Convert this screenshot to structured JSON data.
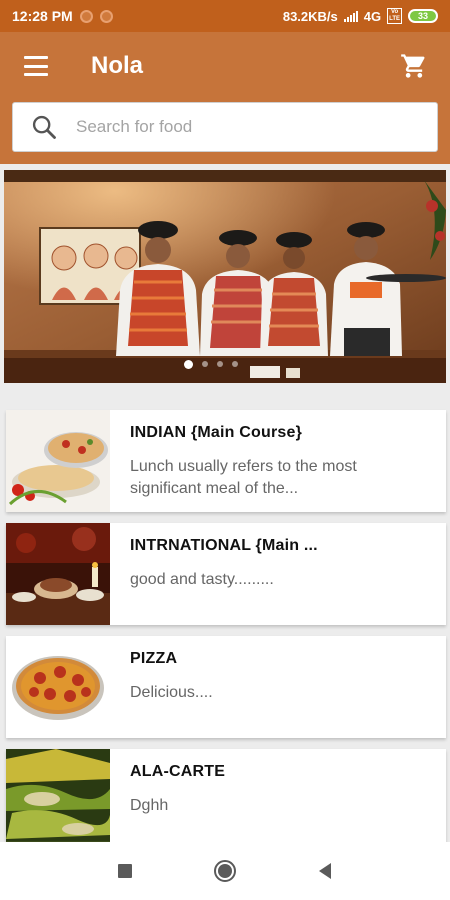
{
  "status_bar": {
    "time": "12:28 PM",
    "network_speed": "83.2KB/s",
    "network_type": "4G",
    "volte": "Vo LTE",
    "battery_level": "33"
  },
  "app_bar": {
    "title": "Nola",
    "menu_icon": "hamburger-menu-icon",
    "cart_icon": "shopping-cart-icon"
  },
  "search": {
    "placeholder": "Search for food",
    "icon": "search-icon"
  },
  "banner": {
    "slide_count": 4,
    "active_slide": 1
  },
  "categories": [
    {
      "title": "INDIAN {Main Course}",
      "description": "Lunch usually refers to the most significant meal of the..."
    },
    {
      "title": "INTRNATIONAL {Main ...",
      "description": "good and tasty........."
    },
    {
      "title": "PIZZA",
      "description": "Delicious...."
    },
    {
      "title": "ALA-CARTE",
      "description": "Dghh"
    }
  ],
  "colors": {
    "status_bar": "#c0601c",
    "app_bar": "#c6743a",
    "background": "#ececec"
  }
}
